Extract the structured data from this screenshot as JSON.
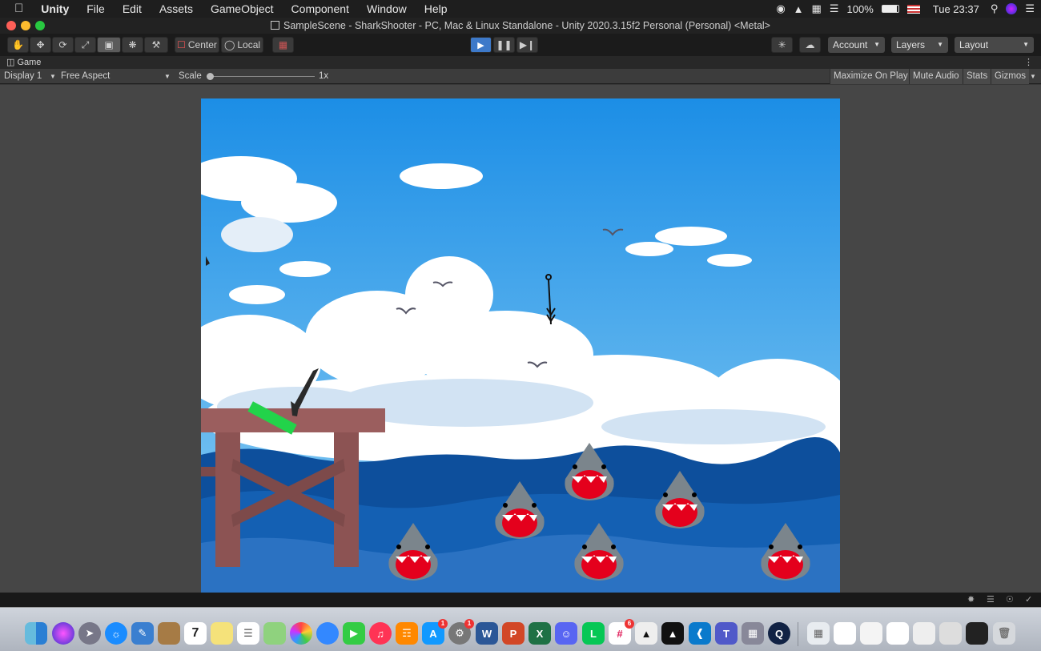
{
  "menubar": {
    "app": "Unity",
    "items": [
      "File",
      "Edit",
      "Assets",
      "GameObject",
      "Component",
      "Window",
      "Help"
    ],
    "battery": "100%",
    "clock": "Tue 23:37"
  },
  "window": {
    "title": "SampleScene - SharkShooter - PC, Mac & Linux Standalone - Unity 2020.3.15f2 Personal (Personal) <Metal>"
  },
  "toolbar": {
    "pivot": "Center",
    "space": "Local",
    "account": "Account",
    "layers": "Layers",
    "layout": "Layout"
  },
  "game_tab": {
    "label": "Game"
  },
  "game_toolbar": {
    "display": "Display 1",
    "aspect": "Free Aspect",
    "scale_label": "Scale",
    "scale_value": "1x",
    "maximize": "Maximize On Play",
    "mute": "Mute Audio",
    "stats": "Stats",
    "gizmos": "Gizmos"
  },
  "colors": {
    "sky_top": "#1c8ee6",
    "sky_bottom": "#7fc6ef",
    "sea": "#0d4f9c",
    "pier": "#9b5e5e",
    "shark_grey": "#7b858c",
    "mouth": "#e4001c",
    "aim_bar": "#22d34a"
  },
  "dock": {
    "badges": [
      "1",
      "1",
      "6"
    ]
  }
}
